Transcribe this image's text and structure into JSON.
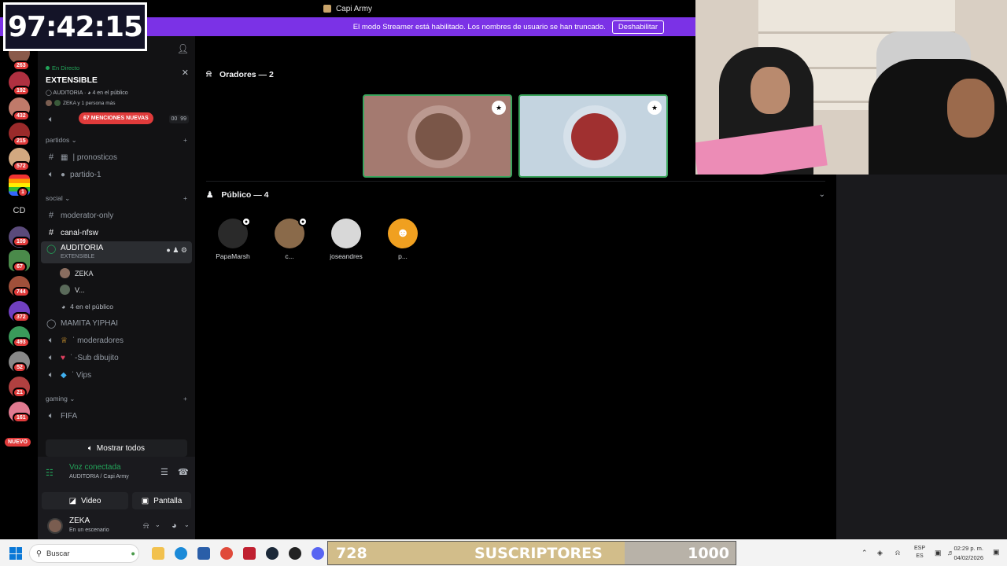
{
  "window_title": "Capi Army",
  "banner": {
    "message": "El modo Streamer está habilitado. Los nombres de usuario se han truncado.",
    "button_label": "Deshabilitar"
  },
  "timer": "97:42:15",
  "rail": {
    "cd_label": "CD",
    "nuevo_label": "NUEVO",
    "badges": [
      "263",
      "192",
      "432",
      "215",
      "572",
      "1",
      "109",
      "67",
      "744",
      "372",
      "493",
      "52",
      "21",
      "161"
    ]
  },
  "live": {
    "status": "En Directo",
    "title": "EXTENSIBLE",
    "stage": "AUDITORIA",
    "audience": "4 en el público",
    "participants": "ZEKA y 1 persona más",
    "mentions_label": "67 MENCIONES NUEVAS",
    "counter_left": "00",
    "counter_right": "99"
  },
  "categories": {
    "partidos": "partidos",
    "social": "social",
    "gaming": "gaming"
  },
  "channels": {
    "pronosticos": "pronosticos",
    "partido1": "partido-1",
    "moderator_only": "moderator-only",
    "canal_nfsw": "canal-nfsw",
    "auditoria": "AUDITORIA",
    "auditoria_topic": "EXTENSIBLE",
    "stage_user1": "ZEKA",
    "stage_user2": "V...",
    "stage_audience": "4 en el público",
    "mamita": "MAMITA YIPHAI",
    "moderadores": "moderadores",
    "sub_dibujito": "-Sub dibujito",
    "vips": "Vips",
    "fifa": "FIFA"
  },
  "show_all_label": "Mostrar todos",
  "voice": {
    "status": "Voz conectada",
    "location": "AUDITORIA / Capi Army",
    "video_label": "Video",
    "screen_label": "Pantalla"
  },
  "user": {
    "name": "ZEKA",
    "status": "En un escenario"
  },
  "stage": {
    "speakers_header": "Oradores — 2",
    "audience_header": "Público — 4",
    "audience": [
      {
        "name": "PapaMarsh",
        "color": "#2a2a2a"
      },
      {
        "name": "c...",
        "color": "#8a6a4a"
      },
      {
        "name": "joseandres",
        "color": "#d8d8d8"
      },
      {
        "name": "p...",
        "color": "#f0a020"
      }
    ]
  },
  "taskbar": {
    "search_placeholder": "Buscar",
    "lang_top": "ESP",
    "lang_bottom": "ES",
    "time": "02:29 p. m.",
    "date": "04/02/2026"
  },
  "subs_goal": {
    "current": "728",
    "label": "SUSCRIPTORES",
    "goal": "1000",
    "progress": 0.728
  }
}
